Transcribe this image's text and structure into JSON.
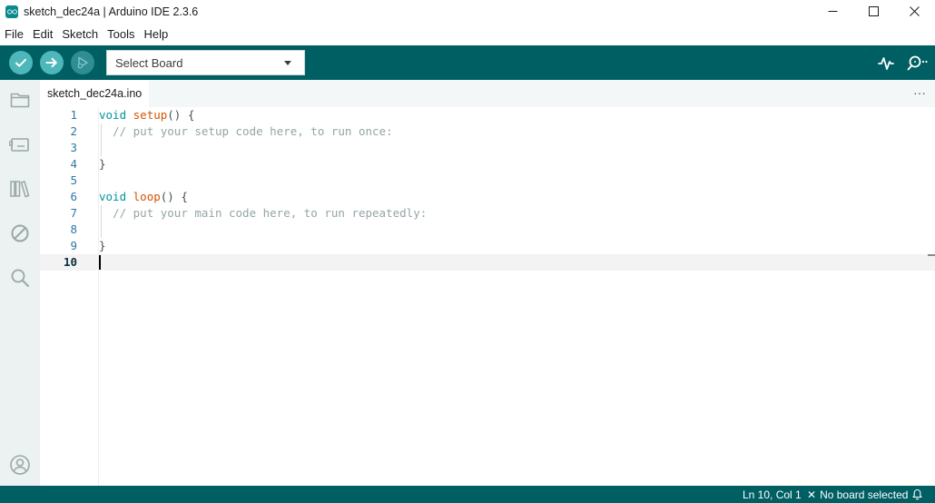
{
  "window": {
    "title": "sketch_dec24a | Arduino IDE 2.3.6",
    "controls": [
      "minimize-icon",
      "maximize-icon",
      "close-icon"
    ]
  },
  "menu": {
    "items": [
      "File",
      "Edit",
      "Sketch",
      "Tools",
      "Help"
    ]
  },
  "toolbar": {
    "buttons": [
      "verify-icon",
      "upload-icon",
      "debug-icon"
    ],
    "board_select": {
      "value": "Select Board"
    },
    "right_icons": [
      "serial-plotter-icon",
      "serial-monitor-icon"
    ]
  },
  "activity_bar": {
    "icons": [
      "sketchbook-folder-icon",
      "boards-manager-icon",
      "library-manager-icon",
      "debug-disabled-icon",
      "search-icon",
      "account-icon"
    ]
  },
  "editor": {
    "tab_label": "sketch_dec24a.ino",
    "more_label": "···",
    "lines": [
      {
        "n": "1",
        "kw": "void",
        "fn": "setup",
        "rest": "() {"
      },
      {
        "n": "2",
        "comment": "// put your setup code here, to run once:"
      },
      {
        "n": "3"
      },
      {
        "n": "4",
        "rest": "}"
      },
      {
        "n": "5"
      },
      {
        "n": "6",
        "kw": "void",
        "fn": "loop",
        "rest": "() {"
      },
      {
        "n": "7",
        "comment": "// put your main code here, to run repeatedly:"
      },
      {
        "n": "8"
      },
      {
        "n": "9",
        "rest": "}"
      },
      {
        "n": "10"
      }
    ]
  },
  "status_bar": {
    "position": "Ln 10, Col 1",
    "board": "No board selected",
    "icons": [
      "close-x-icon",
      "notification-bell-icon"
    ]
  },
  "colors": {
    "teal_dark": "#005f63",
    "teal_light": "#4db7bb",
    "keyword": "#00979c",
    "function": "#d35400",
    "comment": "#95a5a6"
  }
}
